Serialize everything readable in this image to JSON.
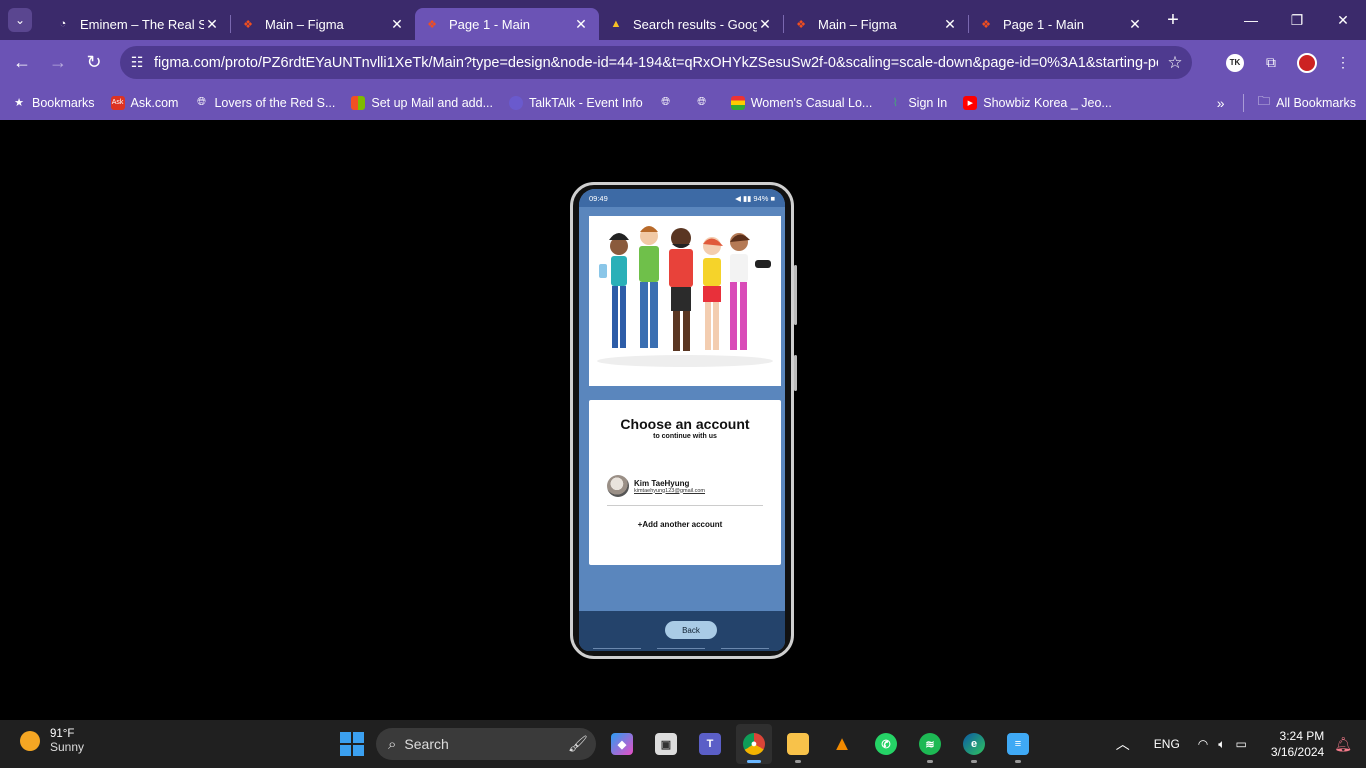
{
  "browser": {
    "tabs": [
      {
        "title": "Eminem – The Real Sl",
        "icon": "genius-icon"
      },
      {
        "title": "Main – Figma",
        "icon": "figma-icon"
      },
      {
        "title": "Page 1 - Main",
        "icon": "figma-icon",
        "active": true
      },
      {
        "title": "Search results - Goog",
        "icon": "google-drive-icon"
      },
      {
        "title": "Main – Figma",
        "icon": "figma-icon"
      },
      {
        "title": "Page 1 - Main",
        "icon": "figma-icon"
      }
    ],
    "url": "figma.com/proto/PZ6rdtEYaUNTnvlli1XeTk/Main?type=design&node-id=44-194&t=qRxOHYkZSesuSw2f-0&scaling=scale-down&page-id=0%3A1&starting-po...",
    "bookmarks": [
      {
        "label": "Bookmarks",
        "icon": "star-icon"
      },
      {
        "label": "Ask.com",
        "icon": "ask-icon"
      },
      {
        "label": "Lovers of the Red S...",
        "icon": "globe-icon"
      },
      {
        "label": "Set up Mail and add...",
        "icon": "microsoft-icon"
      },
      {
        "label": "TalkTAlk - Event Info",
        "icon": "talktalk-icon"
      },
      {
        "label": "",
        "icon": "globe-icon"
      },
      {
        "label": "",
        "icon": "globe-icon"
      },
      {
        "label": "Women's Casual Lo...",
        "icon": "shop-icon"
      },
      {
        "label": "Sign In",
        "icon": "leaf-icon"
      },
      {
        "label": "Showbiz Korea _ Jeo...",
        "icon": "youtube-icon"
      }
    ],
    "all_bookmarks": "All Bookmarks"
  },
  "phone": {
    "status_time": "09:49",
    "status_right": "94%",
    "card_title": "Choose an account",
    "card_subtitle": "to continue with us",
    "account_name": "Kim TaeHyung",
    "account_email": "kimtaehyung123@gmail.com",
    "add_account": "+Add another account",
    "back_label": "Back"
  },
  "taskbar": {
    "temp": "91°F",
    "weather": "Sunny",
    "search": "Search",
    "lang": "ENG",
    "time": "3:24 PM",
    "date": "3/16/2024"
  },
  "colors": {
    "tabbar": "#3b2a6b",
    "toolbar": "#6b53b5",
    "phone_bg": "#5a86bd",
    "phone_nav": "#24436b"
  }
}
